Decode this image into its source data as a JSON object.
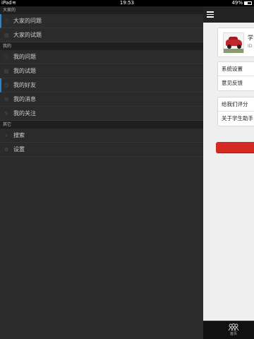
{
  "status_bar": {
    "carrier": "iPad",
    "time": "19:53",
    "battery": "49%",
    "battery_level": 0.49
  },
  "sidebar": {
    "sections": [
      {
        "header": "大家的",
        "items": [
          {
            "label": "大家的问题",
            "icon": "info-icon",
            "active": true
          },
          {
            "label": "大家的试题",
            "icon": "document-icon",
            "active": false
          }
        ]
      },
      {
        "header": "我的",
        "items": [
          {
            "label": "我的问题",
            "icon": "info-icon",
            "active": false
          },
          {
            "label": "我的试题",
            "icon": "document-icon",
            "active": false
          },
          {
            "label": "我的好友",
            "icon": "friend-icon",
            "active": true
          },
          {
            "label": "我的消息",
            "icon": "message-icon",
            "active": false
          },
          {
            "label": "我的关注",
            "icon": "follow-icon",
            "active": false
          }
        ]
      },
      {
        "header": "其它",
        "items": [
          {
            "label": "搜索",
            "icon": "search-icon",
            "active": false
          },
          {
            "label": "设置",
            "icon": "gear-icon",
            "active": false
          }
        ]
      }
    ]
  },
  "panel": {
    "profile": {
      "name": "学",
      "id": "ID"
    },
    "group1": [
      "系统设置",
      "意见反馈"
    ],
    "group2": [
      "给我们评分",
      "关于学生助手"
    ],
    "tabbar": {
      "home_label": "首页"
    },
    "colors": {
      "button": "#d42a22",
      "accent": "#2d83c8"
    }
  }
}
